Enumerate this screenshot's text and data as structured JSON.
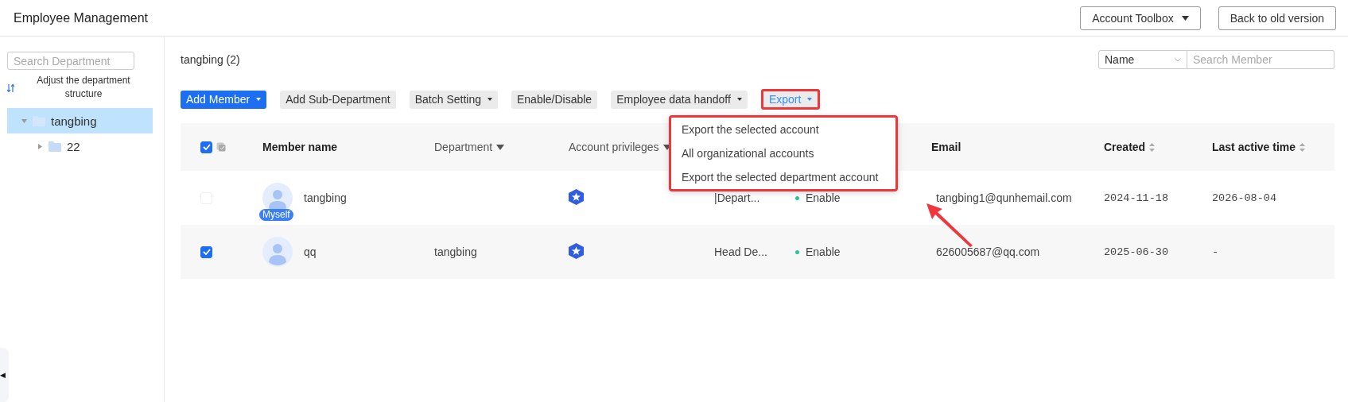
{
  "header": {
    "title": "Employee Management",
    "buttons": [
      {
        "label": "Account Toolbox",
        "caret": true
      },
      {
        "label": "Back to old version",
        "caret": false
      }
    ]
  },
  "sidebar": {
    "search": {
      "placeholder": "Search Department"
    },
    "adjust_link": "Adjust the department structure",
    "tree": [
      {
        "label": "tangbing",
        "expanded": true,
        "selected": true,
        "children": [
          {
            "label": "22",
            "expanded": false,
            "selected": false
          }
        ]
      }
    ],
    "collapse_handle": "◀"
  },
  "main": {
    "heading": "tangbing (2)",
    "search_by": {
      "value": "Name"
    },
    "search_member": {
      "placeholder": "Search Member"
    },
    "toolbar": [
      {
        "label": "Add Member",
        "kind": "primary",
        "caret": true,
        "annotated": false
      },
      {
        "label": "Add Sub-Department",
        "kind": "default",
        "caret": false,
        "annotated": false
      },
      {
        "label": "Batch Setting",
        "kind": "default",
        "caret": true,
        "annotated": false
      },
      {
        "label": "Enable/Disable",
        "kind": "default",
        "caret": false,
        "annotated": false
      },
      {
        "label": "Employee data handoff",
        "kind": "default",
        "caret": true,
        "annotated": false
      },
      {
        "label": "Export",
        "kind": "link",
        "caret": true,
        "annotated": true
      }
    ],
    "export_menu": {
      "annotated": true,
      "items": [
        "Export the selected account",
        "All organizational accounts",
        "Export the selected department account"
      ]
    },
    "table": {
      "all_checked": true,
      "columns": [
        {
          "label": "Member name",
          "kind": "plain"
        },
        {
          "label": "Department",
          "kind": "filter"
        },
        {
          "label": "Account privileges",
          "kind": "filter"
        },
        {
          "kind": "hidden"
        },
        {
          "kind": "hidden"
        },
        {
          "label": "Email",
          "kind": "plain"
        },
        {
          "label": "Created",
          "kind": "sort"
        },
        {
          "label": "Last active time",
          "kind": "sort"
        }
      ],
      "rows": [
        {
          "checked": false,
          "name": "tangbing",
          "badge": "Myself",
          "column_4": "|Depart...",
          "status": "Enable",
          "email": "tangbing1@qunhemail.com",
          "created": "2024-11-18",
          "last_active": "2026-08-04"
        },
        {
          "checked": true,
          "name": "qq",
          "department": "tangbing",
          "column_4": "Head De...",
          "status": "Enable",
          "email": "626005687@qq.com",
          "created": "2025-06-30",
          "last_active": "-"
        }
      ]
    }
  }
}
